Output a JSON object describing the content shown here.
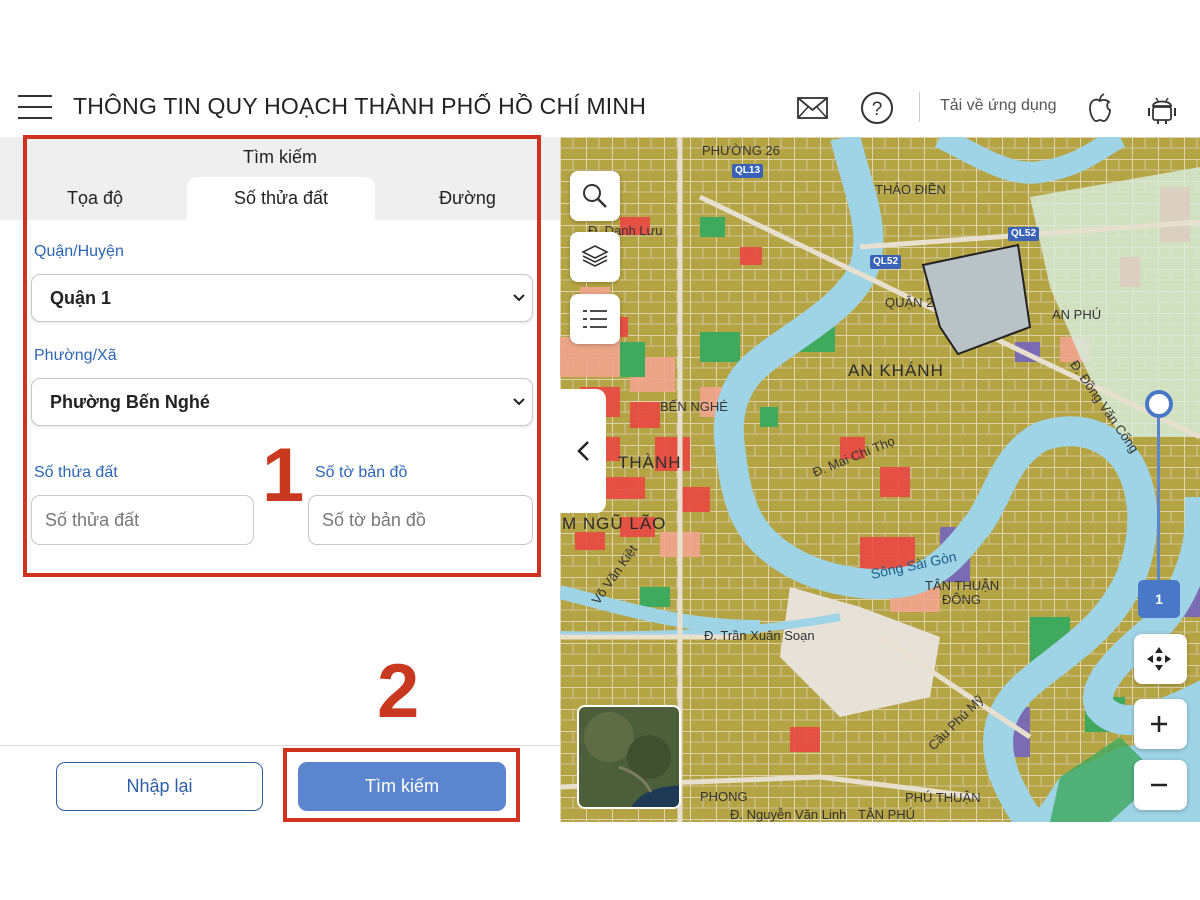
{
  "header": {
    "title": "THÔNG TIN QUY HOẠCH THÀNH PHỐ HỒ CHÍ MINH",
    "download_label": "Tải về ứng dụng",
    "icons": [
      "menu-icon",
      "mail-icon",
      "help-icon",
      "apple-icon",
      "android-icon"
    ]
  },
  "search_panel": {
    "heading": "Tìm kiếm",
    "tabs": [
      {
        "label": "Tọa độ",
        "active": false
      },
      {
        "label": "Số thửa đất",
        "active": true
      },
      {
        "label": "Đường",
        "active": false
      }
    ],
    "district": {
      "label": "Quận/Huyện",
      "value": "Quận 1"
    },
    "ward": {
      "label": "Phường/Xã",
      "value": "Phường Bến Nghé"
    },
    "parcel_number": {
      "label": "Số thửa đất",
      "placeholder": "Số thửa đất"
    },
    "map_sheet": {
      "label": "Số tờ bản đồ",
      "placeholder": "Số tờ bản đồ"
    },
    "reset_button": "Nhập lại",
    "search_button": "Tìm kiếm"
  },
  "annotations": {
    "step_1": "1",
    "step_2": "2",
    "color": "#d0321f"
  },
  "map": {
    "labels": {
      "phuong_26": "PHƯỜNG 26",
      "thao_dien": "THẢO ĐIỀN",
      "quan_2": "QUẬN 2",
      "an_phu": "AN PHÚ",
      "an_khanh": "AN KHÁNH",
      "ben_nghe": "BẾN NGHÉ",
      "thanh": "THÀNH",
      "ngu_lao": "M NGŨ LÃO",
      "mai_chi_tho": "Đ. Mai Chí Thọ",
      "song_sai_gon": "Sông Sài Gòn",
      "tan_thuan_dong_1": "TÂN THUẬN",
      "tan_thuan_dong_2": "ĐÔNG",
      "tran_xuan_soan": "Đ. Trần Xuân Soạn",
      "dong_van_cong": "Đ. Đồng Văn Cống",
      "cau_phu_my": "Cầu Phú Mỹ",
      "phu_thuan": "PHÚ THUẬN",
      "nguyen_van_linh": "Đ. Nguyễn Văn Linh",
      "tan_phu": "TÂN PHÚ",
      "vo_van_kiet": "Võ Văn Kiệt",
      "phong": "PHONG",
      "danh_luu": "Đ. Danh Lưu"
    },
    "road_shields": [
      "QL13",
      "QL52",
      "QL52"
    ],
    "zoom_level": "1",
    "zoom_fraction": 0.1,
    "colors": {
      "residential": "#b5a443",
      "river": "#9fd3e6",
      "commercial": "#e84a44",
      "green": "#3fa95d",
      "road": "#e8e0cf",
      "selection": "#b9c2c6",
      "accent": "#4a78c8"
    },
    "tools": [
      "search-icon",
      "layers-icon",
      "list-icon",
      "locate-icon",
      "zoom-in-icon",
      "zoom-out-icon",
      "collapse-arrow-icon"
    ]
  }
}
